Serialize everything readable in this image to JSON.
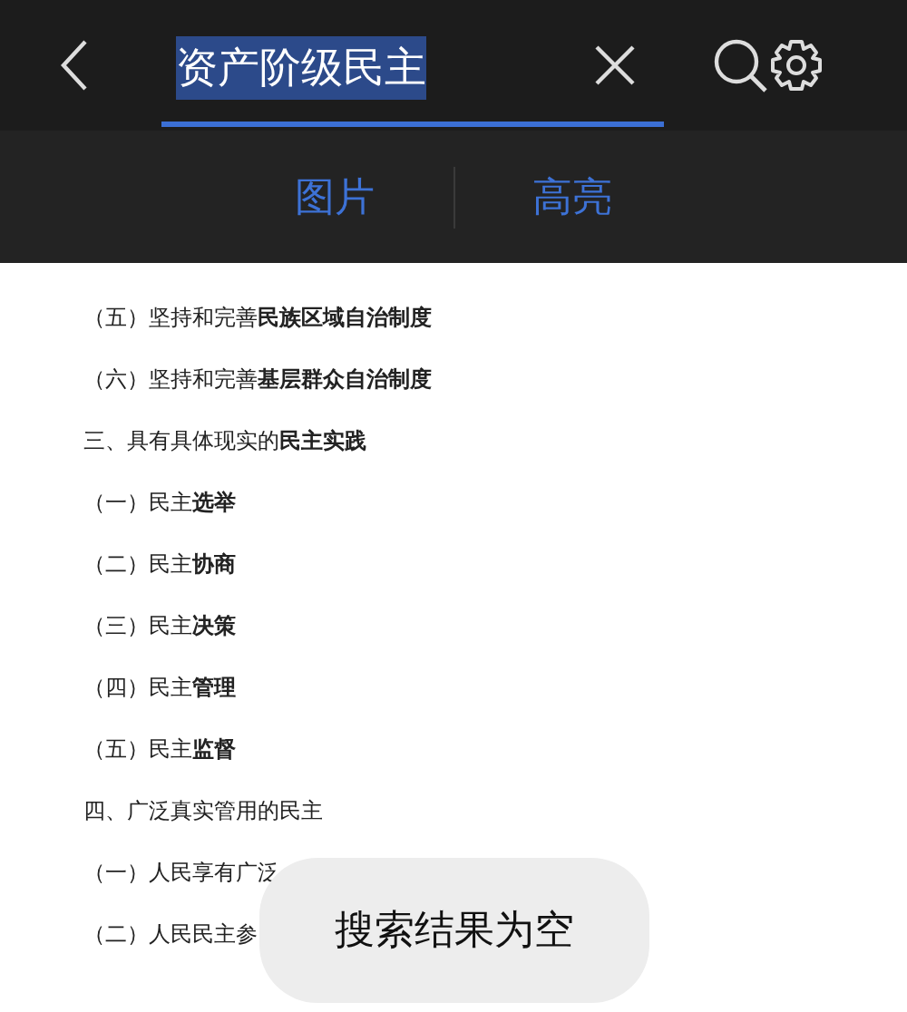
{
  "search": {
    "value": "资产阶级民主"
  },
  "tabs": [
    {
      "label": "图片"
    },
    {
      "label": "高亮"
    }
  ],
  "lines": [
    "（五）坚持和完善**民族区域自治制度**",
    "（六）坚持和完善**基层群众自治制度**",
    "三、具有具体现实的**民主实践**",
    "（一）民主**选举**",
    "（二）民主**协商**",
    "（三）民主**决策**",
    "（四）民主**管理**",
    "（五）民主**监督**",
    "四、广泛真实管用的民主",
    "（一）人民享有广泛",
    "（二）人民民主参"
  ],
  "toast": "搜索结果为空"
}
